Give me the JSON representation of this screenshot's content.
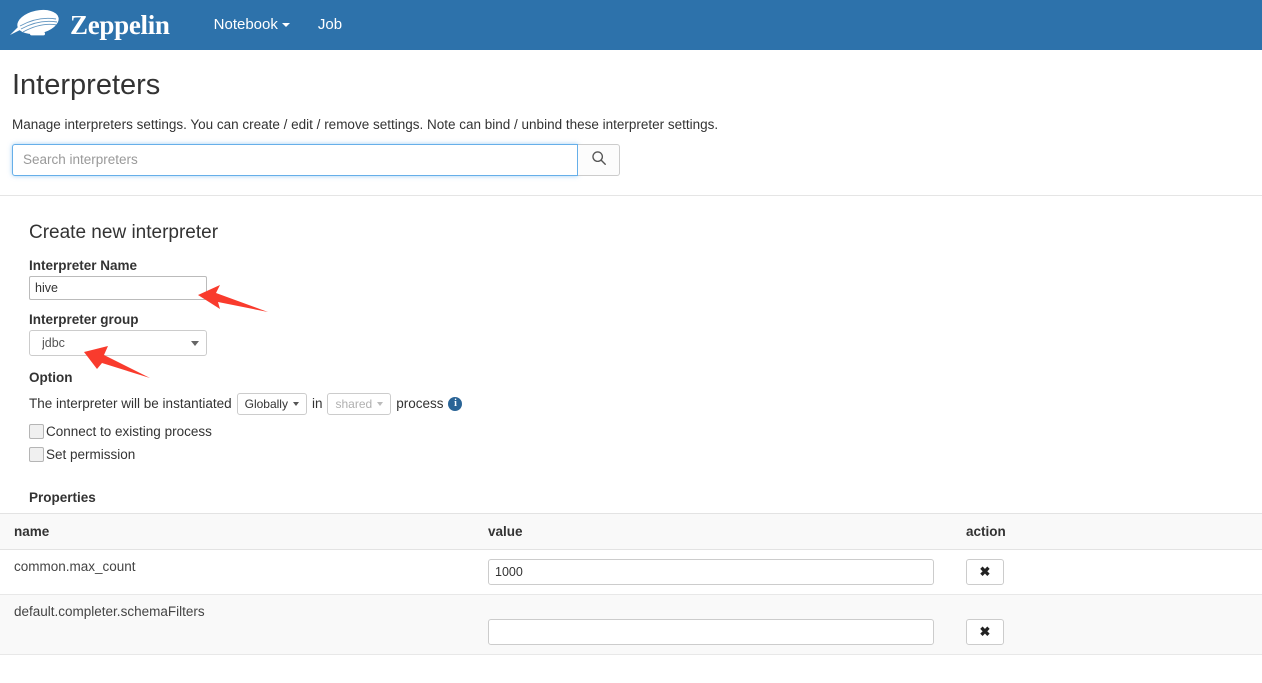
{
  "navbar": {
    "brand": "Zeppelin",
    "logo_icon": "zeppelin-airship-logo",
    "items": [
      {
        "label": "Notebook",
        "has_caret": true
      },
      {
        "label": "Job",
        "has_caret": false
      }
    ]
  },
  "page": {
    "title": "Interpreters",
    "description": "Manage interpreters settings. You can create / edit / remove settings. Note can bind / unbind these interpreter settings."
  },
  "search": {
    "placeholder": "Search interpreters",
    "value": "",
    "button_icon": "search-icon"
  },
  "create": {
    "title": "Create new interpreter",
    "name_label": "Interpreter Name",
    "name_value": "hive",
    "group_label": "Interpreter group",
    "group_value": "jdbc",
    "group_options": [
      "jdbc"
    ]
  },
  "option": {
    "title": "Option",
    "sentence_prefix": "The interpreter will be instantiated",
    "scope_value": "Globally",
    "sentence_middle": "in",
    "process_value": "shared",
    "sentence_suffix": "process",
    "info_icon": "info-icon",
    "checkboxes": [
      {
        "label": "Connect to existing process",
        "checked": false
      },
      {
        "label": "Set permission",
        "checked": false
      }
    ]
  },
  "properties": {
    "title": "Properties",
    "columns": [
      "name",
      "value",
      "action"
    ],
    "rows": [
      {
        "name": "common.max_count",
        "value": "1000",
        "action_icon": "remove-icon",
        "action_label": "✖"
      },
      {
        "name": "default.completer.schemaFilters",
        "value": "",
        "action_icon": "remove-icon",
        "action_label": "✖"
      }
    ]
  },
  "annotations": {
    "arrow_color": "#f93b2d",
    "arrows": [
      {
        "target": "interpreter-name-input"
      },
      {
        "target": "interpreter-group-select"
      }
    ]
  }
}
